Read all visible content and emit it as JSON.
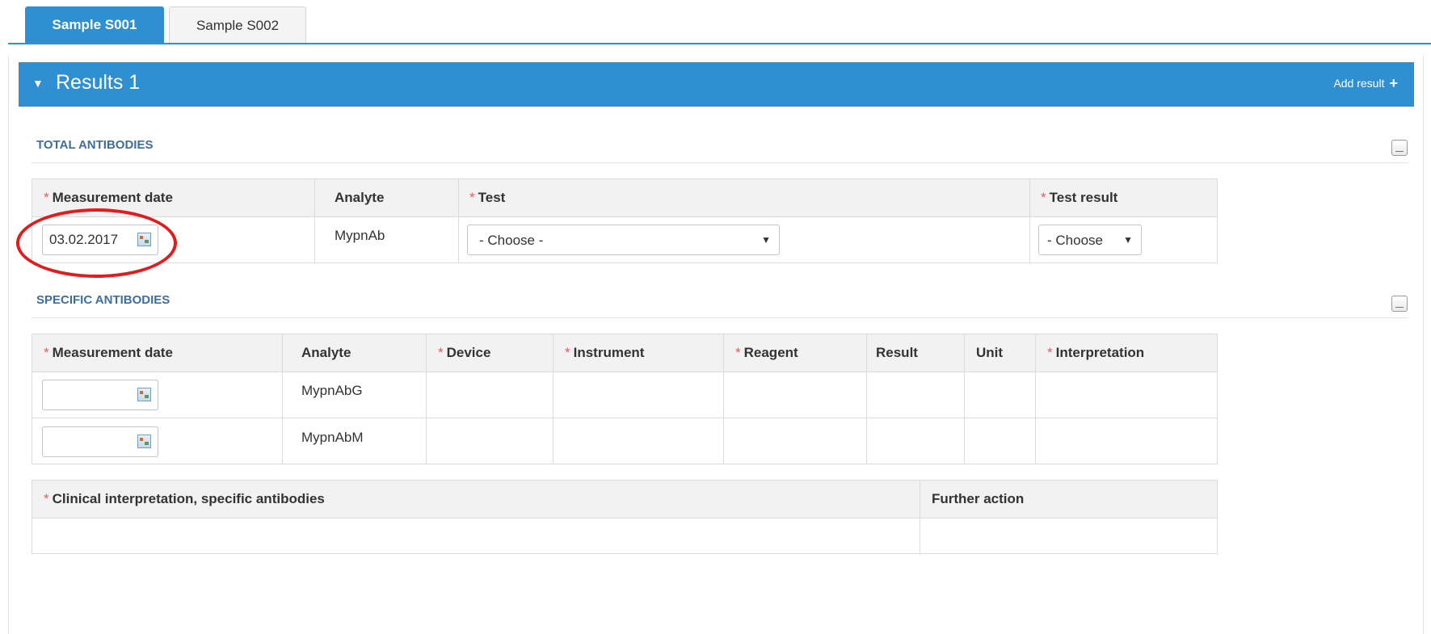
{
  "tabs": [
    {
      "label": "Sample S001",
      "active": true
    },
    {
      "label": "Sample S002",
      "active": false
    }
  ],
  "results_panel": {
    "title": "Results 1",
    "add_result_label": "Add result"
  },
  "total_antibodies": {
    "title": "TOTAL ANTIBODIES",
    "headers": {
      "measurement_date": "Measurement date",
      "analyte": "Analyte",
      "test": "Test",
      "test_result": "Test result"
    },
    "row": {
      "measurement_date": "03.02.2017",
      "analyte": "MypnAb",
      "test": "- Choose -",
      "test_result": "- Choose"
    }
  },
  "specific_antibodies": {
    "title": "SPECIFIC ANTIBODIES",
    "headers": {
      "measurement_date": "Measurement date",
      "analyte": "Analyte",
      "device": "Device",
      "instrument": "Instrument",
      "reagent": "Reagent",
      "result": "Result",
      "unit": "Unit",
      "interpretation": "Interpretation"
    },
    "rows": [
      {
        "measurement_date": "",
        "analyte": "MypnAbG"
      },
      {
        "measurement_date": "",
        "analyte": "MypnAbM"
      }
    ]
  },
  "clinical": {
    "headers": {
      "clinical_interpretation": "Clinical interpretation, specific antibodies",
      "further_action": "Further action"
    }
  },
  "required_marker": "*",
  "colors": {
    "accent": "#2f8fd0",
    "section_title": "#3d6ea0",
    "required": "#e05a5a",
    "highlight_circle": "#e01c1c"
  }
}
